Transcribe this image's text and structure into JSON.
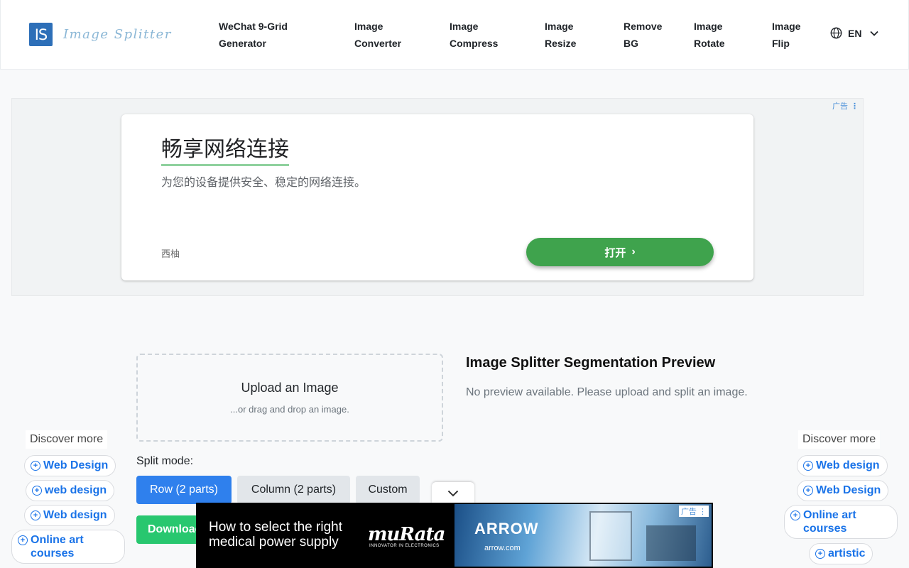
{
  "header": {
    "logo_mark": "IS",
    "logo_text": "Image Splitter",
    "nav": [
      {
        "label": "WeChat 9-Grid\nGenerator"
      },
      {
        "label": "Image\nConverter"
      },
      {
        "label": "Image\nCompress"
      },
      {
        "label": "Image\nResize"
      },
      {
        "label": "Remove\nBG"
      },
      {
        "label": "Image\nRotate"
      },
      {
        "label": "Image\nFlip"
      }
    ],
    "lang": "EN"
  },
  "ad_top": {
    "tag": "广告",
    "title": "畅享网络连接",
    "subtitle": "为您的设备提供安全、稳定的网络连接。",
    "brand": "西柚",
    "button": "打开"
  },
  "upload": {
    "title": "Upload an Image",
    "subtitle": "...or drag and drop an image."
  },
  "preview": {
    "title": "Image Splitter Segmentation Preview",
    "empty_text": "No preview available. Please upload and split an image."
  },
  "split": {
    "label": "Split mode:",
    "modes": [
      "Row (2 parts)",
      "Column (2 parts)",
      "Custom"
    ],
    "download": "Download"
  },
  "left_side": {
    "heading": "Discover more",
    "pills": [
      "Web Design",
      "web design",
      "Web design",
      "Online art courses"
    ]
  },
  "right_side": {
    "heading": "Discover more",
    "pills": [
      "Web design",
      "Web Design",
      "Online art courses",
      "artistic"
    ]
  },
  "ad_bottom": {
    "text": "How to select the right medical power supply",
    "brand": "muRata",
    "brand_sub": "INNOVATOR IN ELECTRONICS",
    "partner": "ARROW",
    "partner_url": "arrow.com",
    "tag": "广告"
  },
  "colors": {
    "primary": "#2f80ed",
    "success": "#28c76f",
    "ad_green": "#3fa34d",
    "link": "#1a73e8"
  }
}
